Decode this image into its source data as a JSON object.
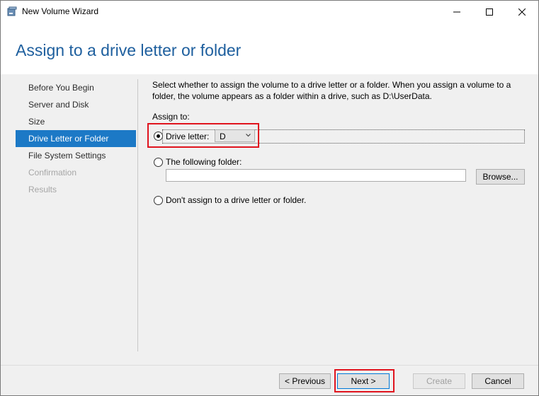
{
  "window": {
    "title": "New Volume Wizard",
    "controls": [
      "minimize-icon",
      "maximize-icon",
      "close-icon"
    ]
  },
  "page": {
    "title": "Assign to a drive letter or folder"
  },
  "nav": {
    "items": [
      {
        "label": "Before You Begin",
        "state": "normal"
      },
      {
        "label": "Server and Disk",
        "state": "normal"
      },
      {
        "label": "Size",
        "state": "normal"
      },
      {
        "label": "Drive Letter or Folder",
        "state": "active"
      },
      {
        "label": "File System Settings",
        "state": "normal"
      },
      {
        "label": "Confirmation",
        "state": "disabled"
      },
      {
        "label": "Results",
        "state": "disabled"
      }
    ]
  },
  "content": {
    "description": "Select whether to assign the volume to a drive letter or a folder. When you assign a volume to a folder, the volume appears as a folder within a drive, such as D:\\UserData.",
    "assign_to_label": "Assign to:",
    "options": {
      "drive_letter": {
        "label": "Drive letter:",
        "selected": true,
        "value": "D"
      },
      "folder": {
        "label": "The following folder:",
        "selected": false,
        "value": "",
        "browse_label": "Browse..."
      },
      "none": {
        "label": "Don't assign to a drive letter or folder.",
        "selected": false
      }
    }
  },
  "footer": {
    "previous_label": "< Previous",
    "next_label": "Next >",
    "create_label": "Create",
    "cancel_label": "Cancel"
  },
  "colors": {
    "accent": "#1c79c6",
    "title_blue": "#1e5f9e",
    "highlight_red": "#e0141e"
  }
}
